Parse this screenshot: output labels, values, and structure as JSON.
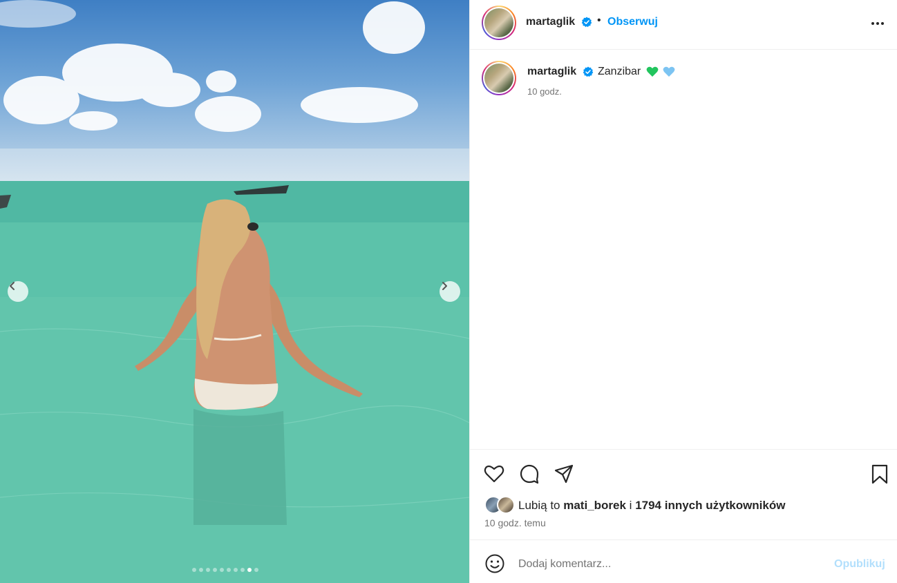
{
  "post": {
    "username": "martaglik",
    "follow_label": "Obserwuj",
    "separator": "•",
    "caption": "Zanzibar",
    "caption_emojis": [
      "green-heart",
      "light-blue-heart"
    ],
    "posted_ago": "10 godz.",
    "likes": {
      "prefix": "Lubią to",
      "first_user": "mati_borek",
      "joiner": "i",
      "others": "1794 innych użytkowników"
    },
    "likes_time": "10 godz. temu"
  },
  "carousel": {
    "slide_count": 10,
    "active_index": 8
  },
  "comment": {
    "placeholder": "Dodaj komentarz...",
    "publish_label": "Opublikuj"
  },
  "colors": {
    "accent_blue": "#0095f6",
    "publish_disabled": "#b2dffc",
    "verified_blue": "#0095f6",
    "text_primary": "#262626",
    "text_secondary": "#737373"
  },
  "icons": [
    "more-options-icon",
    "like-icon",
    "comment-icon",
    "share-icon",
    "save-icon",
    "emoji-icon",
    "chevron-left-icon",
    "chevron-right-icon",
    "verified-badge-icon"
  ]
}
